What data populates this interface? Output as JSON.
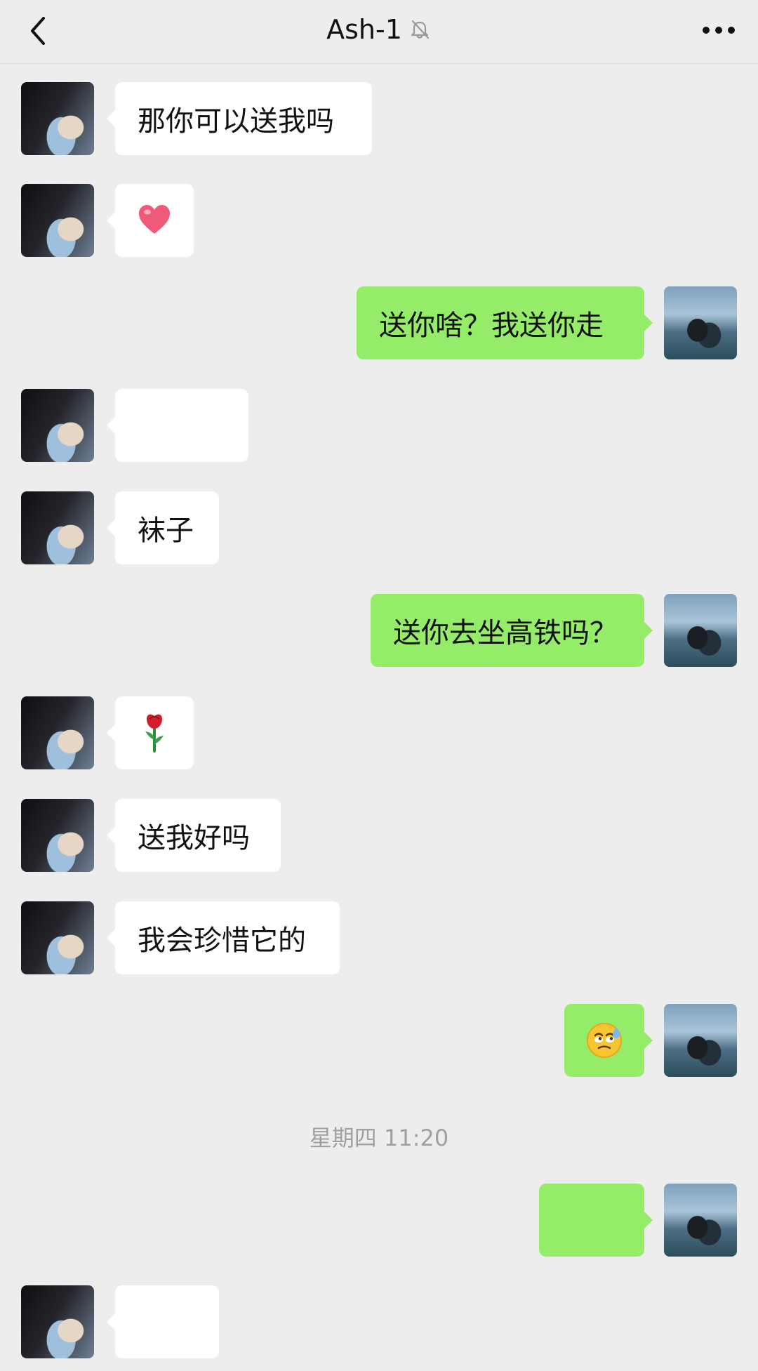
{
  "header": {
    "title": "Ash-1",
    "back_icon": "chevron-left-icon",
    "mute_icon": "bell-off-icon",
    "more_icon": "ellipsis-icon"
  },
  "messages": [
    {
      "side": "left",
      "type": "text",
      "text": "那你可以送我吗"
    },
    {
      "side": "left",
      "type": "emoji",
      "emoji": "heart"
    },
    {
      "side": "right",
      "type": "text",
      "text": "送你啥？我送你走"
    },
    {
      "side": "left",
      "type": "text",
      "text": ""
    },
    {
      "side": "left",
      "type": "text",
      "text": "袜子"
    },
    {
      "side": "right",
      "type": "text",
      "text": "送你去坐高铁吗？"
    },
    {
      "side": "left",
      "type": "emoji",
      "emoji": "rose"
    },
    {
      "side": "left",
      "type": "text",
      "text": "送我好吗"
    },
    {
      "side": "left",
      "type": "text",
      "text": "我会珍惜它的"
    },
    {
      "side": "right",
      "type": "emoji",
      "emoji": "face-with-rolling-eyes-sweat"
    },
    {
      "side": "right",
      "type": "text",
      "text": ""
    },
    {
      "side": "left",
      "type": "text",
      "text": ""
    }
  ],
  "timestamp": "星期四 11:20",
  "colors": {
    "background": "#ededed",
    "incoming_bubble": "#ffffff",
    "outgoing_bubble": "#95ec69",
    "timestamp_text": "#a0a0a0"
  }
}
